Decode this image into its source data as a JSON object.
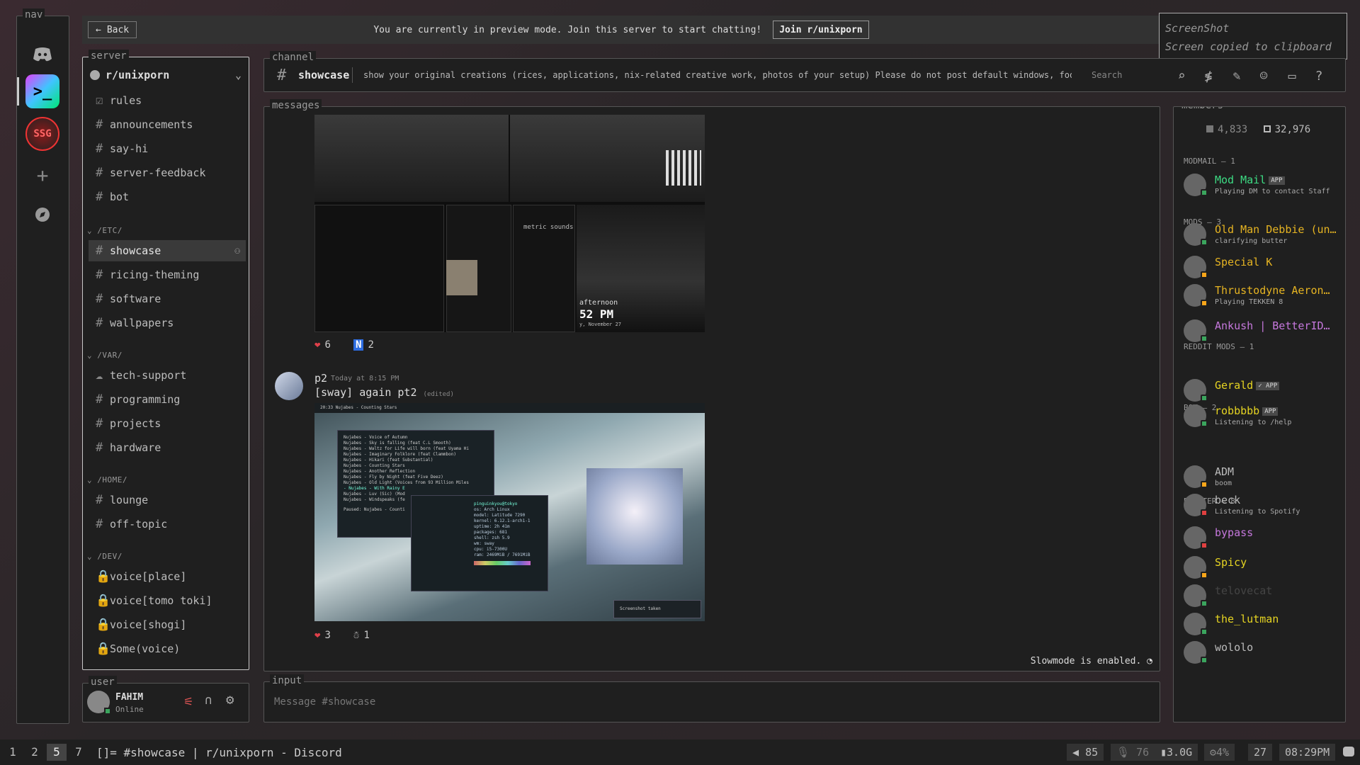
{
  "app": {
    "title": "[]= #showcase | r/unixporn - Discord"
  },
  "nav": {
    "legend": "nav",
    "add_label": "+"
  },
  "topbar": {
    "back": "Back",
    "message": "You are currently in preview mode. Join this server to start chatting!",
    "join": "Join r/unixporn"
  },
  "toast": {
    "title": "ScreenShot",
    "text": "Screen copied to clipboard"
  },
  "server": {
    "legend": "server",
    "name": "r/unixporn",
    "channels_top": [
      {
        "label": "rules"
      },
      {
        "label": "announcements"
      },
      {
        "label": "say-hi"
      },
      {
        "label": "server-feedback"
      },
      {
        "label": "bot"
      }
    ],
    "cat_etc": "/ETC/",
    "channels_etc": [
      {
        "label": "showcase"
      },
      {
        "label": "ricing-theming"
      },
      {
        "label": "software"
      },
      {
        "label": "wallpapers"
      }
    ],
    "cat_var": "/VAR/",
    "channels_var": [
      {
        "label": "tech-support"
      },
      {
        "label": "programming"
      },
      {
        "label": "projects"
      },
      {
        "label": "hardware"
      }
    ],
    "cat_home": "/HOME/",
    "channels_home": [
      {
        "label": "lounge"
      },
      {
        "label": "off-topic"
      }
    ],
    "cat_dev": "/DEV/",
    "channels_dev": [
      {
        "label": "voice[place]"
      },
      {
        "label": "voice[tomo toki]"
      },
      {
        "label": "voice[shogi]"
      },
      {
        "label": "Some(voice)"
      }
    ]
  },
  "user": {
    "legend": "user",
    "name": "FAHIM",
    "status": "Online"
  },
  "channel": {
    "legend": "channel",
    "name": "showcase",
    "topic": "show your original creations (rices, applications, nix-related creative work, photos of your setup) Please do not post default windows, food, music, or o…",
    "search_placeholder": "Search"
  },
  "messages": {
    "legend": "messages",
    "reactions1": [
      {
        "emoji": "❤",
        "count": "6"
      },
      {
        "emoji": "N",
        "count": "2"
      }
    ],
    "post": {
      "author": "p2",
      "time": "Today at 8:15 PM",
      "text": "[sway] again pt2",
      "edited": "(edited)"
    },
    "reactions2": [
      {
        "emoji": "❤",
        "count": "3"
      },
      {
        "emoji": "☃",
        "count": "1"
      }
    ],
    "img1_labels": {
      "metric": "metric sounds",
      "afternoon": "afternoon",
      "clock": "52 PM",
      "date": "y, November 27"
    },
    "img2_labels": {
      "statusbar": "20:33  Nujabes - Counting Stars",
      "screenshot": "Screenshot taken",
      "neofetch_host": "pinguinkyou@tokyo",
      "os": "os: Arch Linux",
      "model": "model: Latitude 7290",
      "kernel": "kernel: 6.12.1-arch1-1",
      "uptime": "uptime: 2h 41m",
      "packages": "packages: 681",
      "shell": "shell: zsh 5.9",
      "wm": "wm: sway",
      "cpu": "cpu: i5-7300U",
      "ram": "ram: 2469MiB / 7691MiB",
      "tracks": [
        "Nujabes - Voice of Autumn",
        "Nujabes - Sky is falling (feat C.L Smooth)",
        "Nujabes - Waltz for Life will born (feat Uyama Hi",
        "Nujabes - Imaginary Folklore (feat Clammbon)",
        "Nujabes - Hikari (feat Substantial)",
        "Nujabes - Counting Stars",
        "Nujabes - Another Reflection",
        "Nujabes - Fly by Night (feat Five Deez)",
        "Nujabes - Old Light (Voices from 93 Million Miles",
        "- Nujabes - With Rainy E",
        "Nujabes - Luv (Sic) (Mod",
        "Nujabes - Windspeaks (fe"
      ],
      "paused": "Paused: Nujabes - Counti"
    },
    "slowmode": "Slowmode is enabled."
  },
  "input": {
    "legend": "input",
    "placeholder": "Message #showcase"
  },
  "members": {
    "legend": "members",
    "online": "4,833",
    "total": "32,976",
    "groups": {
      "modmail": "MODMAIL — 1",
      "mods": "MODS — 3",
      "reddit": "REDDIT MODS — 1",
      "bot": "BOT — 2",
      "booster": "BOOSTER — 8"
    },
    "list": [
      {
        "name": "Mod Mail",
        "tag": "APP",
        "status": "Playing DM to contact Staff",
        "color": "#3ddc84"
      },
      {
        "name": "Old Man Debbie (un…",
        "status": "clarifying butter",
        "color": "#e6b422"
      },
      {
        "name": "Special K",
        "status": "",
        "color": "#e6b422"
      },
      {
        "name": "Thrustodyne Aeron…",
        "status": "Playing TEKKEN 8",
        "color": "#e6b422"
      },
      {
        "name": "Ankush | BetterID…",
        "status": "",
        "color": "#c678dd"
      },
      {
        "name": "Gerald",
        "tag": "✓ APP",
        "status": "",
        "color": "#e6d422"
      },
      {
        "name": "robbbbb",
        "tag": "APP",
        "status": "Listening to /help",
        "color": "#e6d422"
      },
      {
        "name": "ADM",
        "status": "boom",
        "color": "#bbbbbb"
      },
      {
        "name": "beck",
        "status": "Listening to Spotify",
        "color": "#bbbbbb"
      },
      {
        "name": "bypass",
        "status": "",
        "color": "#c678dd"
      },
      {
        "name": "Spicy",
        "status": "",
        "color": "#e6d422"
      },
      {
        "name": "telovecat",
        "status": "",
        "color": "#444444"
      },
      {
        "name": "the_lutman",
        "status": "",
        "color": "#e6d422"
      },
      {
        "name": "wololo",
        "status": "",
        "color": "#bbbbbb"
      }
    ]
  },
  "statusbar": {
    "workspaces": [
      "1",
      "2",
      "5",
      "7"
    ],
    "title": "[]= #showcase | r/unixporn - Discord",
    "volume": "85",
    "mic": "76",
    "mem": "3.0G",
    "cpu": "4%",
    "day": "27",
    "time": "08:29PM"
  },
  "colors": {
    "accent": "#e6b422",
    "bg": "#1f1f1f",
    "panel": "#323232"
  }
}
